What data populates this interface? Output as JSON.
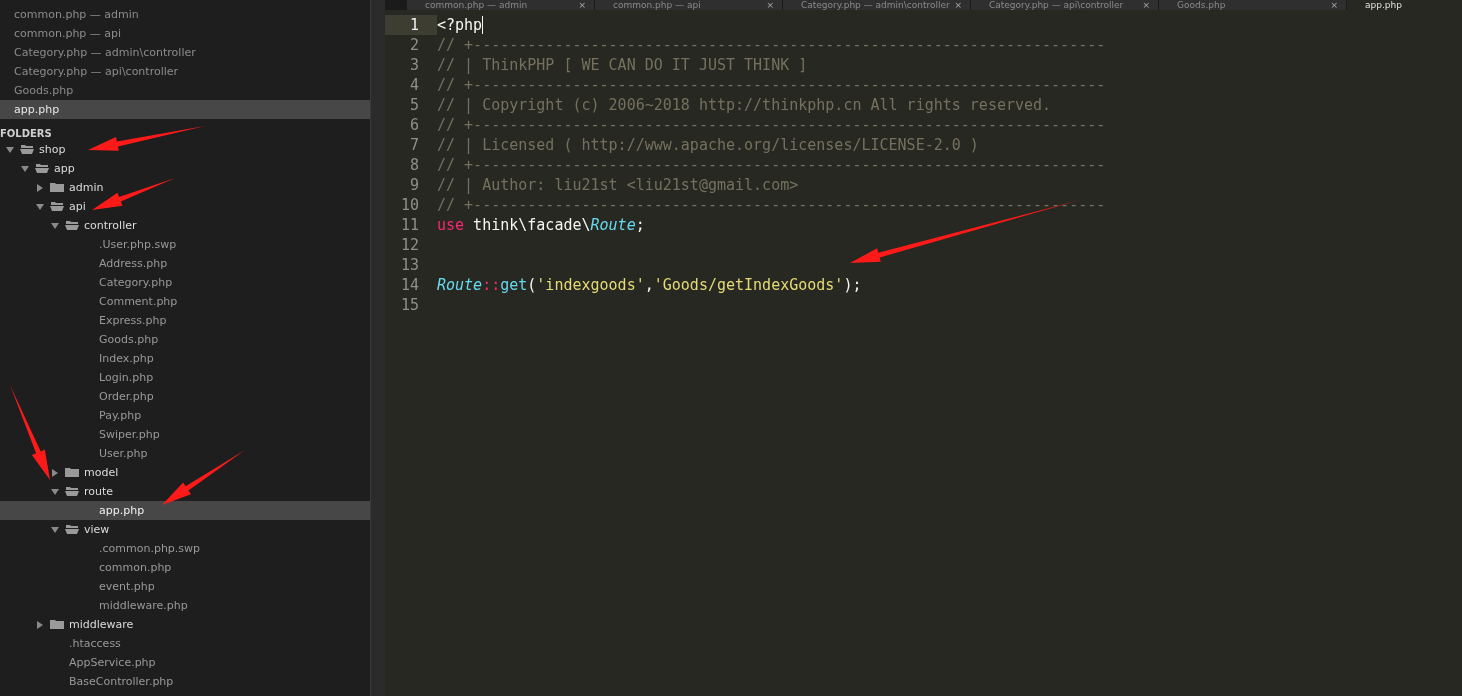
{
  "open_files": [
    {
      "label": "common.php — admin",
      "selected": false
    },
    {
      "label": "common.php — api",
      "selected": false
    },
    {
      "label": "Category.php — admin\\controller",
      "selected": false
    },
    {
      "label": "Category.php — api\\controller",
      "selected": false
    },
    {
      "label": "Goods.php",
      "selected": false
    },
    {
      "label": "app.php",
      "selected": true
    }
  ],
  "folders_title": "FOLDERS",
  "tree": [
    {
      "name": "shop",
      "kind": "folder",
      "expanded": true,
      "selected": false,
      "children": [
        {
          "name": "app",
          "kind": "folder",
          "expanded": true,
          "selected": false,
          "children": [
            {
              "name": "admin",
              "kind": "folder",
              "expanded": false,
              "selected": false
            },
            {
              "name": "api",
              "kind": "folder",
              "expanded": true,
              "selected": false,
              "children": [
                {
                  "name": "controller",
                  "kind": "folder",
                  "expanded": true,
                  "selected": false,
                  "children": [
                    {
                      "name": ".User.php.swp",
                      "kind": "file",
                      "selected": false
                    },
                    {
                      "name": "Address.php",
                      "kind": "file",
                      "selected": false
                    },
                    {
                      "name": "Category.php",
                      "kind": "file",
                      "selected": false
                    },
                    {
                      "name": "Comment.php",
                      "kind": "file",
                      "selected": false
                    },
                    {
                      "name": "Express.php",
                      "kind": "file",
                      "selected": false
                    },
                    {
                      "name": "Goods.php",
                      "kind": "file",
                      "selected": false
                    },
                    {
                      "name": "Index.php",
                      "kind": "file",
                      "selected": false
                    },
                    {
                      "name": "Login.php",
                      "kind": "file",
                      "selected": false
                    },
                    {
                      "name": "Order.php",
                      "kind": "file",
                      "selected": false
                    },
                    {
                      "name": "Pay.php",
                      "kind": "file",
                      "selected": false
                    },
                    {
                      "name": "Swiper.php",
                      "kind": "file",
                      "selected": false
                    },
                    {
                      "name": "User.php",
                      "kind": "file",
                      "selected": false
                    }
                  ]
                },
                {
                  "name": "model",
                  "kind": "folder",
                  "expanded": false,
                  "selected": false
                },
                {
                  "name": "route",
                  "kind": "folder",
                  "expanded": true,
                  "selected": false,
                  "children": [
                    {
                      "name": "app.php",
                      "kind": "file",
                      "selected": true
                    }
                  ]
                },
                {
                  "name": "view",
                  "kind": "folder",
                  "expanded": true,
                  "selected": false,
                  "children": [
                    {
                      "name": ".common.php.swp",
                      "kind": "file",
                      "selected": false
                    },
                    {
                      "name": "common.php",
                      "kind": "file",
                      "selected": false
                    },
                    {
                      "name": "event.php",
                      "kind": "file",
                      "selected": false
                    },
                    {
                      "name": "middleware.php",
                      "kind": "file",
                      "selected": false
                    }
                  ]
                }
              ]
            },
            {
              "name": "middleware",
              "kind": "folder",
              "expanded": false,
              "selected": false
            },
            {
              "name": ".htaccess",
              "kind": "file",
              "selected": false
            },
            {
              "name": "AppService.php",
              "kind": "file",
              "selected": false
            },
            {
              "name": "BaseController.php",
              "kind": "file",
              "selected": false
            }
          ]
        }
      ]
    }
  ],
  "tabs": [
    {
      "label": "common.php — admin",
      "selected": false,
      "close": "×"
    },
    {
      "label": "common.php — api",
      "selected": false,
      "close": "×"
    },
    {
      "label": "Category.php — admin\\controller",
      "selected": false,
      "close": "×"
    },
    {
      "label": "Category.php — api\\controller",
      "selected": false,
      "close": "×"
    },
    {
      "label": "Goods.php",
      "selected": false,
      "close": "×"
    },
    {
      "label": "app.php",
      "selected": true
    }
  ],
  "lines": [
    {
      "number": "1",
      "selected": true,
      "tokens": [
        {
          "kind": "plain",
          "text": "<?php"
        }
      ]
    },
    {
      "number": "2",
      "selected": false,
      "tokens": [
        {
          "kind": "comment",
          "text": "// +----------------------------------------------------------------------"
        }
      ]
    },
    {
      "number": "3",
      "selected": false,
      "tokens": [
        {
          "kind": "comment",
          "text": "// | ThinkPHP [ WE CAN DO IT JUST THINK ]"
        }
      ]
    },
    {
      "number": "4",
      "selected": false,
      "tokens": [
        {
          "kind": "comment",
          "text": "// +----------------------------------------------------------------------"
        }
      ]
    },
    {
      "number": "5",
      "selected": false,
      "tokens": [
        {
          "kind": "comment",
          "text": "// | Copyright (c) 2006~2018 http://thinkphp.cn All rights reserved."
        }
      ]
    },
    {
      "number": "6",
      "selected": false,
      "tokens": [
        {
          "kind": "comment",
          "text": "// +----------------------------------------------------------------------"
        }
      ]
    },
    {
      "number": "7",
      "selected": false,
      "tokens": [
        {
          "kind": "comment",
          "text": "// | Licensed ( http://www.apache.org/licenses/LICENSE-2.0 )"
        }
      ]
    },
    {
      "number": "8",
      "selected": false,
      "tokens": [
        {
          "kind": "comment",
          "text": "// +----------------------------------------------------------------------"
        }
      ]
    },
    {
      "number": "9",
      "selected": false,
      "tokens": [
        {
          "kind": "comment",
          "text": "// | Author: liu21st <liu21st@gmail.com>"
        }
      ]
    },
    {
      "number": "10",
      "selected": false,
      "tokens": [
        {
          "kind": "comment",
          "text": "// +----------------------------------------------------------------------"
        }
      ]
    },
    {
      "number": "11",
      "selected": false,
      "tokens": [
        {
          "kind": "keyword",
          "text": "use"
        },
        {
          "kind": "plain",
          "text": " think\\facade\\"
        },
        {
          "kind": "class",
          "text": "Route"
        },
        {
          "kind": "plain",
          "text": ";"
        }
      ]
    },
    {
      "number": "12",
      "selected": false
    },
    {
      "number": "13",
      "selected": false
    },
    {
      "number": "14",
      "selected": false,
      "tokens": [
        {
          "kind": "class",
          "text": "Route"
        },
        {
          "kind": "operator",
          "text": "::"
        },
        {
          "kind": "function",
          "text": "get"
        },
        {
          "kind": "plain",
          "text": "("
        },
        {
          "kind": "string",
          "text": "'indexgoods'"
        },
        {
          "kind": "plain",
          "text": ","
        },
        {
          "kind": "string",
          "text": "'Goods/getIndexGoods'"
        },
        {
          "kind": "plain",
          "text": ");"
        }
      ]
    },
    {
      "number": "15",
      "selected": false
    }
  ]
}
